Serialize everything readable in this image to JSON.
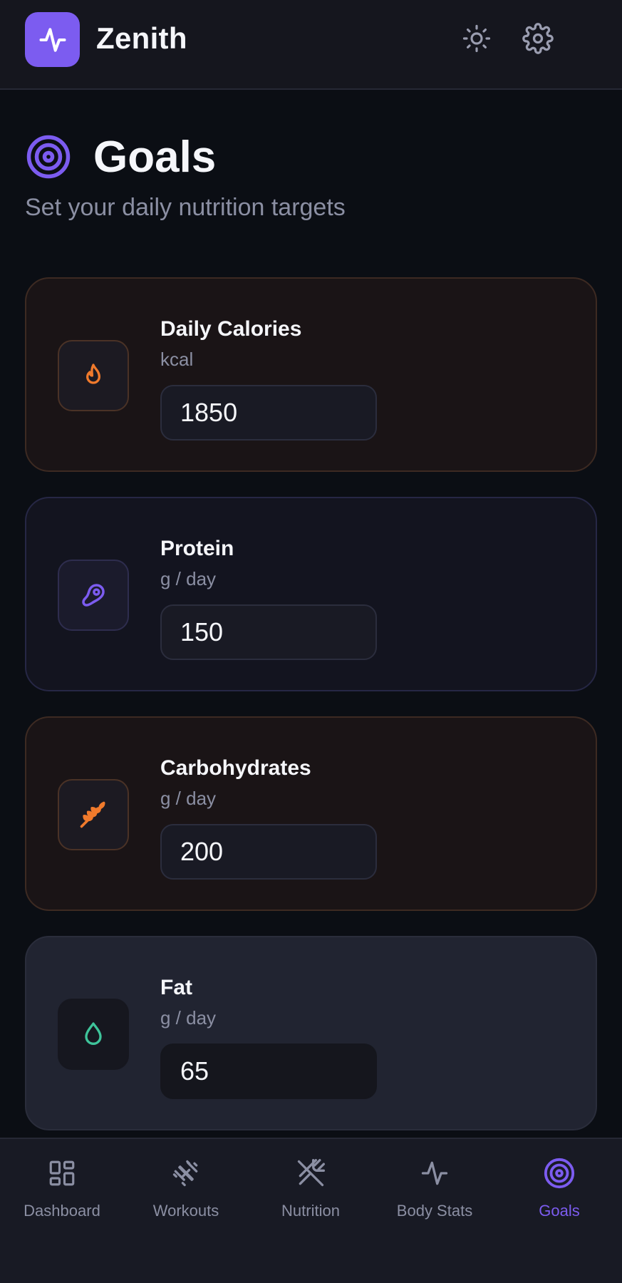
{
  "app": {
    "name": "Zenith"
  },
  "header": {
    "icons": [
      "sun-icon",
      "gear-icon"
    ]
  },
  "page": {
    "title": "Goals",
    "subtitle": "Set your daily nutrition targets"
  },
  "goals": [
    {
      "title": "Daily Calories",
      "unit": "kcal",
      "value": "1850",
      "icon": "flame-icon",
      "accent": "#f07a2c"
    },
    {
      "title": "Protein",
      "unit": "g / day",
      "value": "150",
      "icon": "steak-icon",
      "accent": "#7c5cf0"
    },
    {
      "title": "Carbohydrates",
      "unit": "g / day",
      "value": "200",
      "icon": "wheat-icon",
      "accent": "#f07a2c"
    },
    {
      "title": "Fat",
      "unit": "g / day",
      "value": "65",
      "icon": "droplet-icon",
      "accent": "#3ec49a"
    }
  ],
  "nav": [
    {
      "label": "Dashboard",
      "icon": "dashboard-icon",
      "active": false
    },
    {
      "label": "Workouts",
      "icon": "dumbbell-icon",
      "active": false
    },
    {
      "label": "Nutrition",
      "icon": "utensils-icon",
      "active": false
    },
    {
      "label": "Body Stats",
      "icon": "activity-icon",
      "active": false
    },
    {
      "label": "Goals",
      "icon": "target-icon",
      "active": true
    }
  ],
  "colors": {
    "accent": "#7c5cf0",
    "orange": "#f07a2c",
    "green": "#3ec49a",
    "muted": "#8b8fa3"
  }
}
